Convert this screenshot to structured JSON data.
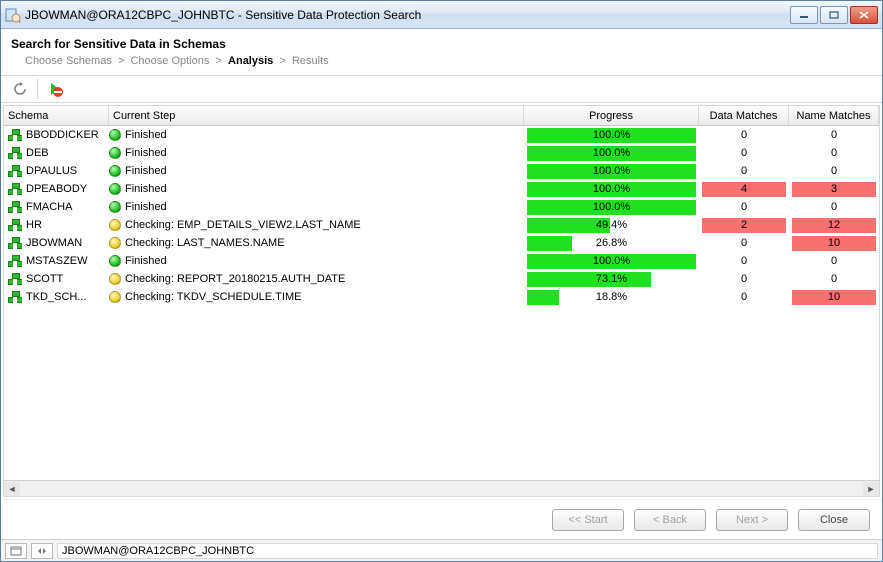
{
  "window": {
    "title": "JBOWMAN@ORA12CBPC_JOHNBTC - Sensitive Data Protection Search"
  },
  "heading": "Search for Sensitive Data in Schemas",
  "breadcrumb": {
    "items": [
      "Choose Schemas",
      "Choose Options",
      "Analysis",
      "Results"
    ],
    "active_index": 2
  },
  "columns": {
    "schema": "Schema",
    "step": "Current Step",
    "progress": "Progress",
    "data_matches": "Data Matches",
    "name_matches": "Name Matches"
  },
  "rows": [
    {
      "schema": "BBODDICKER",
      "status": "green",
      "step": "Finished",
      "progress": 100.0,
      "progress_label": "100.0%",
      "data_matches": 0,
      "name_matches": 0,
      "data_alert": false,
      "name_alert": false
    },
    {
      "schema": "DEB",
      "status": "green",
      "step": "Finished",
      "progress": 100.0,
      "progress_label": "100.0%",
      "data_matches": 0,
      "name_matches": 0,
      "data_alert": false,
      "name_alert": false
    },
    {
      "schema": "DPAULUS",
      "status": "green",
      "step": "Finished",
      "progress": 100.0,
      "progress_label": "100.0%",
      "data_matches": 0,
      "name_matches": 0,
      "data_alert": false,
      "name_alert": false
    },
    {
      "schema": "DPEABODY",
      "status": "green",
      "step": "Finished",
      "progress": 100.0,
      "progress_label": "100.0%",
      "data_matches": 4,
      "name_matches": 3,
      "data_alert": true,
      "name_alert": true
    },
    {
      "schema": "FMACHA",
      "status": "green",
      "step": "Finished",
      "progress": 100.0,
      "progress_label": "100.0%",
      "data_matches": 0,
      "name_matches": 0,
      "data_alert": false,
      "name_alert": false
    },
    {
      "schema": "HR",
      "status": "yellow",
      "step": "Checking: EMP_DETAILS_VIEW2.LAST_NAME",
      "progress": 49.4,
      "progress_label": "49.4%",
      "data_matches": 2,
      "name_matches": 12,
      "data_alert": true,
      "name_alert": true
    },
    {
      "schema": "JBOWMAN",
      "status": "yellow",
      "step": "Checking: LAST_NAMES.NAME",
      "progress": 26.8,
      "progress_label": "26.8%",
      "data_matches": 0,
      "name_matches": 10,
      "data_alert": false,
      "name_alert": true
    },
    {
      "schema": "MSTASZEW",
      "status": "green",
      "step": "Finished",
      "progress": 100.0,
      "progress_label": "100.0%",
      "data_matches": 0,
      "name_matches": 0,
      "data_alert": false,
      "name_alert": false
    },
    {
      "schema": "SCOTT",
      "status": "yellow",
      "step": "Checking: REPORT_20180215.AUTH_DATE",
      "progress": 73.1,
      "progress_label": "73.1%",
      "data_matches": 0,
      "name_matches": 0,
      "data_alert": false,
      "name_alert": false
    },
    {
      "schema": "TKD_SCH...",
      "status": "yellow",
      "step": "Checking: TKDV_SCHEDULE.TIME",
      "progress": 18.8,
      "progress_label": "18.8%",
      "data_matches": 0,
      "name_matches": 10,
      "data_alert": false,
      "name_alert": true
    }
  ],
  "buttons": {
    "start": "<< Start",
    "back": "< Back",
    "next": "Next >",
    "close": "Close"
  },
  "statusbar": {
    "text": "JBOWMAN@ORA12CBPC_JOHNBTC"
  }
}
